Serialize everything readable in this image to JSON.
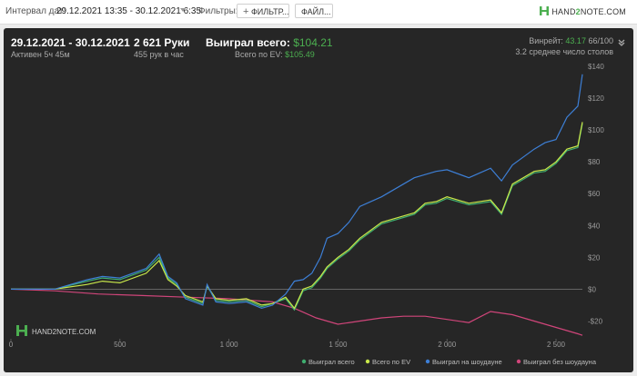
{
  "toolbar": {
    "interval_label": "Интервал дат:",
    "interval_value": "29.12.2021 13:35 - 30.12.2021 6:35",
    "filters_label": "Фильтры:",
    "filter_button": "ФИЛЬТР...",
    "file_button": "ФАЙЛ...",
    "brand_prefix": "HAND",
    "brand_accent": "2",
    "brand_suffix": "NOTE.COM"
  },
  "stats": {
    "date_range": "29.12.2021 - 30.12.2021",
    "active": "Активен 5ч 45м",
    "hands": "2 621 Руки",
    "hands_per_hour": "455 рук в час",
    "won_label": "Выиграл всего:",
    "won_value": "$104.21",
    "ev_label": "Всего по EV:",
    "ev_value": "$105.49",
    "winrate_label": "Винрейт:",
    "winrate_value": "43.17",
    "winrate_count": "66/100",
    "avg_tables": "3.2 среднее число столов"
  },
  "watermark": "HAND2NOTE.COM",
  "chart_data": {
    "type": "line",
    "xlim": [
      0,
      2621
    ],
    "ylim": [
      -30,
      140
    ],
    "x_ticks": [
      0,
      500,
      1000,
      1500,
      2000,
      2500
    ],
    "x_tick_labels": [
      "0",
      "500",
      "1 000",
      "1 500",
      "2 000",
      "2 500"
    ],
    "y_ticks": [
      -20,
      0,
      20,
      40,
      60,
      80,
      100,
      120,
      140
    ],
    "y_tick_labels": [
      "-$20",
      "$0",
      "$20",
      "$40",
      "$60",
      "$80",
      "$100",
      "$120",
      "$140"
    ],
    "grid": false,
    "legend_position": "bottom-right",
    "series": [
      {
        "name": "Выиграл на шоудауне",
        "color": "#3d7fd6",
        "x": [
          0,
          100,
          200,
          350,
          420,
          500,
          620,
          680,
          720,
          760,
          800,
          880,
          900,
          940,
          1000,
          1080,
          1150,
          1200,
          1260,
          1300,
          1340,
          1380,
          1420,
          1450,
          1500,
          1550,
          1600,
          1700,
          1800,
          1850,
          1900,
          1950,
          2000,
          2100,
          2200,
          2250,
          2300,
          2400,
          2450,
          2500,
          2550,
          2600,
          2621
        ],
        "y": [
          0,
          0,
          0,
          6,
          8,
          7,
          13,
          22,
          8,
          4,
          -6,
          -10,
          3,
          -8,
          -9,
          -8,
          -12,
          -10,
          -3,
          5,
          6,
          10,
          20,
          32,
          35,
          42,
          52,
          58,
          66,
          70,
          72,
          74,
          75,
          70,
          76,
          68,
          78,
          88,
          92,
          94,
          108,
          115,
          135
        ]
      },
      {
        "name": "Всего по EV",
        "color": "#c9e84a",
        "x": [
          0,
          100,
          200,
          350,
          420,
          500,
          620,
          680,
          720,
          760,
          800,
          880,
          900,
          940,
          1000,
          1080,
          1150,
          1200,
          1260,
          1300,
          1340,
          1380,
          1420,
          1450,
          1500,
          1550,
          1600,
          1700,
          1800,
          1850,
          1900,
          1950,
          2000,
          2100,
          2200,
          2250,
          2300,
          2400,
          2450,
          2500,
          2550,
          2600,
          2621
        ],
        "y": [
          0,
          0,
          0,
          3,
          5,
          4,
          10,
          18,
          6,
          2,
          -4,
          -8,
          2,
          -6,
          -7,
          -6,
          -10,
          -9,
          -5,
          -12,
          0,
          2,
          8,
          14,
          20,
          25,
          32,
          42,
          46,
          48,
          54,
          55,
          58,
          54,
          56,
          48,
          66,
          74,
          75,
          80,
          88,
          90,
          105
        ]
      },
      {
        "name": "Выиграл всего",
        "color": "#3fae6f",
        "x": [
          0,
          100,
          200,
          350,
          420,
          500,
          620,
          680,
          720,
          760,
          800,
          880,
          900,
          940,
          1000,
          1080,
          1150,
          1200,
          1260,
          1300,
          1340,
          1380,
          1420,
          1450,
          1500,
          1550,
          1600,
          1700,
          1800,
          1850,
          1900,
          1950,
          2000,
          2100,
          2200,
          2250,
          2300,
          2400,
          2450,
          2500,
          2550,
          2600,
          2621
        ],
        "y": [
          0,
          0,
          0,
          5,
          7,
          6,
          12,
          20,
          7,
          3,
          -5,
          -9,
          2,
          -7,
          -8,
          -7,
          -11,
          -9,
          -6,
          -13,
          -1,
          1,
          7,
          13,
          19,
          24,
          31,
          41,
          45,
          47,
          53,
          54,
          57,
          53,
          55,
          47,
          65,
          73,
          74,
          79,
          87,
          89,
          104
        ]
      },
      {
        "name": "Выиграл без шоудауна",
        "color": "#d0457a",
        "x": [
          0,
          200,
          400,
          600,
          800,
          1000,
          1200,
          1300,
          1400,
          1500,
          1600,
          1700,
          1800,
          1900,
          2000,
          2100,
          2200,
          2300,
          2400,
          2500,
          2600,
          2621
        ],
        "y": [
          0,
          -1,
          -3,
          -4,
          -5,
          -6,
          -8,
          -12,
          -18,
          -22,
          -20,
          -18,
          -17,
          -17,
          -19,
          -21,
          -14,
          -16,
          -20,
          -24,
          -28,
          -29
        ]
      }
    ]
  }
}
